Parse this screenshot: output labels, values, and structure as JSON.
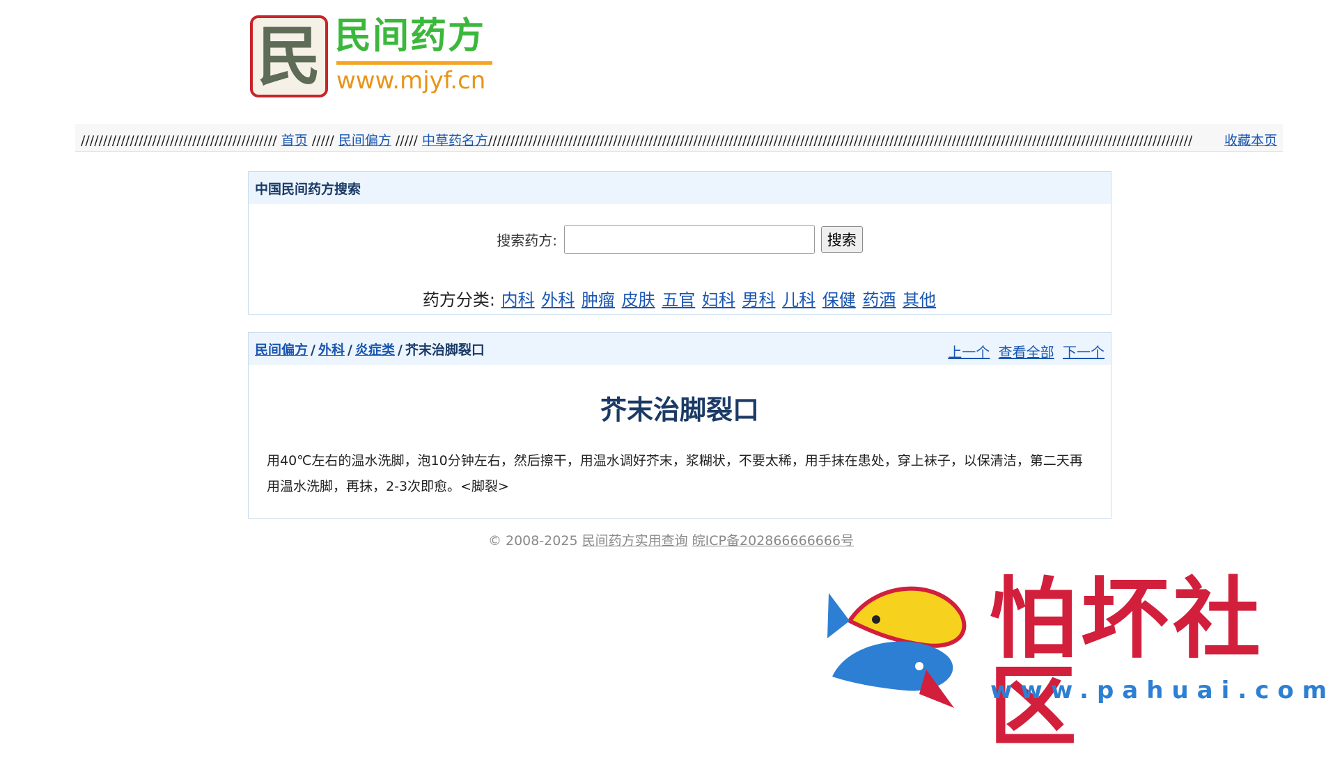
{
  "logo": {
    "char": "民",
    "name": "民间药方",
    "url": "www.mjyf.cn"
  },
  "nav": {
    "slashes_a": "////////////////////////////////////////////",
    "home": "首页",
    "slashes_b": "/////",
    "folk": "民间偏方",
    "slashes_c": "/////",
    "herbal": "中草药名方",
    "slashes_d": "////////////////////////////////////////////////////////////////////////////////////////////////////////////////////////////////////////////////////////////////////",
    "bookmark": "收藏本页"
  },
  "search": {
    "heading": "中国民间药方搜索",
    "label": "搜索药方:",
    "input_value": "",
    "button": "搜索",
    "cat_label": "药方分类:",
    "categories": [
      "内科",
      "外科",
      "肿瘤",
      "皮肤",
      "五官",
      "妇科",
      "男科",
      "儿科",
      "保健",
      "药酒",
      "其他"
    ]
  },
  "article": {
    "crumbs": [
      "民间偏方",
      "外科",
      "炎症类"
    ],
    "crumb_sep": "/",
    "current": "芥末治脚裂口",
    "prev": "上一个",
    "all": "查看全部",
    "next": "下一个",
    "title": "芥末治脚裂口",
    "body": "用40℃左右的温水洗脚，泡10分钟左右，然后擦干，用温水调好芥末，浆糊状，不要太稀，用手抹在患处，穿上袜子，以保清洁，第二天再用温水洗脚，再抹，2-3次即愈。<脚裂>"
  },
  "footer": {
    "copyright": "© 2008-2025",
    "site_link": "民间药方实用查询",
    "icp": "皖ICP备202866666666号"
  },
  "watermark": {
    "title": "怕坏社区",
    "url": "www.pahuai.com"
  },
  "colors": {
    "link": "#1a56b0",
    "heading": "#1b3a66",
    "panel_head_bg": "#ecf5fd",
    "logo_green": "#3bb83b",
    "logo_orange": "#e89419",
    "watermark_red": "#d21f3c",
    "watermark_blue": "#2d7fd3"
  }
}
